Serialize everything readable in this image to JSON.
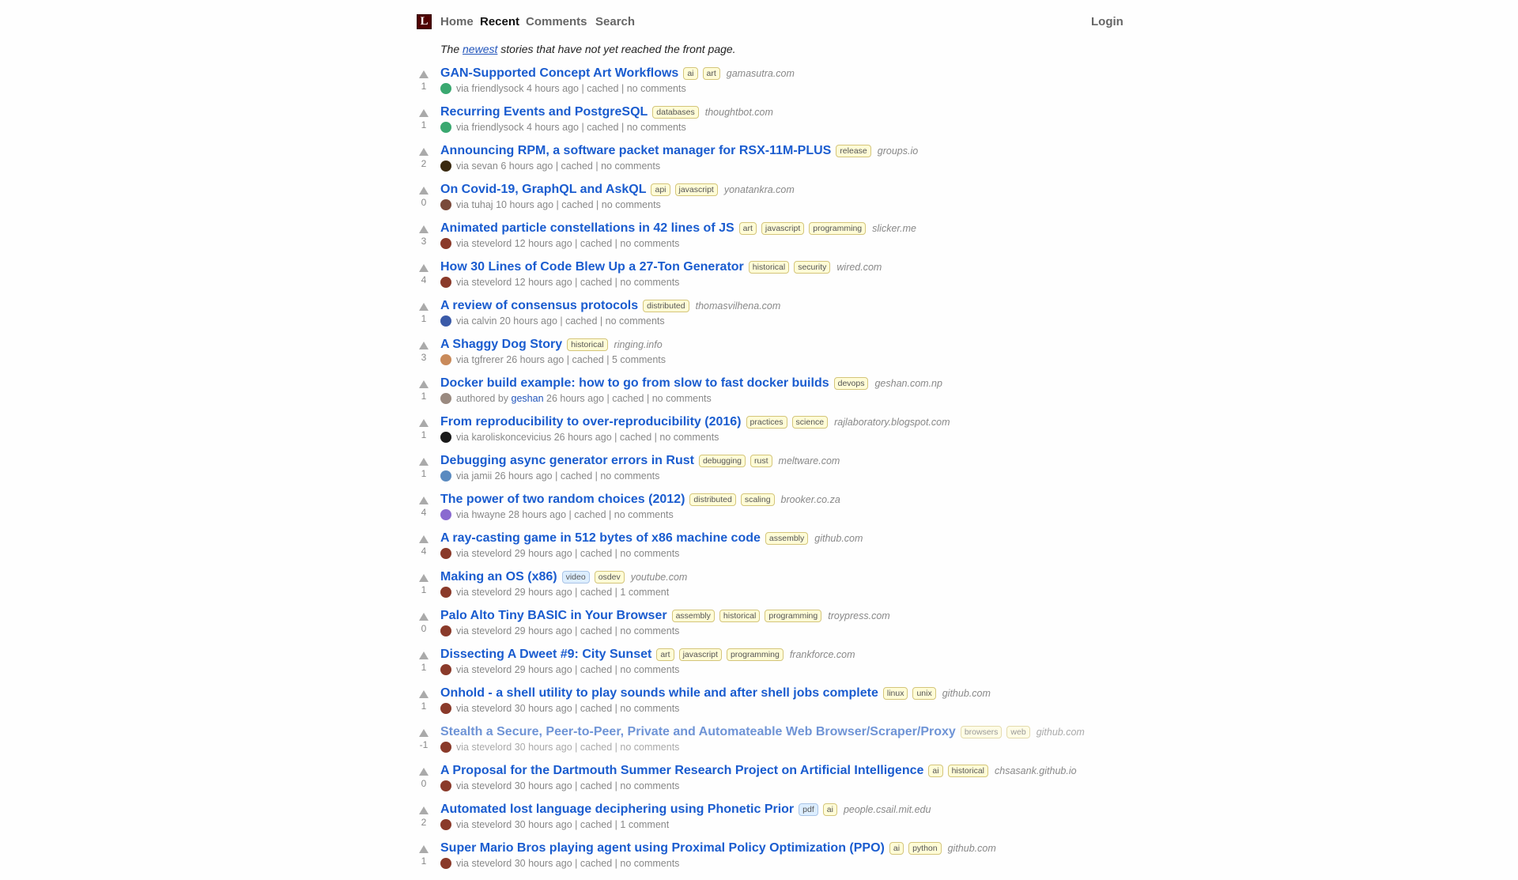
{
  "site": {
    "logo_letter": "L"
  },
  "nav": [
    {
      "label": "Home",
      "active": false
    },
    {
      "label": "Recent",
      "active": true
    },
    {
      "label": "Comments",
      "active": false
    },
    {
      "label": "Search",
      "active": false
    }
  ],
  "login_label": "Login",
  "subtitle": {
    "pre": "The ",
    "link": "newest",
    "post": " stories that have not yet reached the front page."
  },
  "colors": {
    "link": "#1a5ccf",
    "tag_bg": "#fffcd7",
    "media_tag_bg": "#ddeeff",
    "logo": "#500000"
  },
  "stories": [
    {
      "score": "1",
      "title": "GAN-Supported Concept Art Workflows",
      "tags": [
        "ai",
        "art"
      ],
      "domain": "gamasutra.com",
      "prefix": "via",
      "user": "friendlysock",
      "time": "4 hours ago",
      "cached": "cached",
      "comments": "no comments",
      "avatar": "#3aa870"
    },
    {
      "score": "1",
      "title": "Recurring Events and PostgreSQL",
      "tags": [
        "databases"
      ],
      "domain": "thoughtbot.com",
      "prefix": "via",
      "user": "friendlysock",
      "time": "4 hours ago",
      "cached": "cached",
      "comments": "no comments",
      "avatar": "#3aa870"
    },
    {
      "score": "2",
      "title": "Announcing RPM, a software packet manager for RSX-11M-PLUS",
      "tags": [
        "release"
      ],
      "domain": "groups.io",
      "prefix": "via",
      "user": "sevan",
      "time": "6 hours ago",
      "cached": "cached",
      "comments": "no comments",
      "avatar": "#3a2a10"
    },
    {
      "score": "0",
      "title": "On Covid-19, GraphQL and AskQL",
      "tags": [
        "api",
        "javascript"
      ],
      "domain": "yonatankra.com",
      "prefix": "via",
      "user": "tuhaj",
      "time": "10 hours ago",
      "cached": "cached",
      "comments": "no comments",
      "avatar": "#7a4a3a"
    },
    {
      "score": "3",
      "title": "Animated particle constellations in 42 lines of JS",
      "tags": [
        "art",
        "javascript",
        "programming"
      ],
      "domain": "slicker.me",
      "prefix": "via",
      "user": "stevelord",
      "time": "12 hours ago",
      "cached": "cached",
      "comments": "no comments",
      "avatar": "#8a3a2a"
    },
    {
      "score": "4",
      "title": "How 30 Lines of Code Blew Up a 27-Ton Generator",
      "tags": [
        "historical",
        "security"
      ],
      "domain": "wired.com",
      "prefix": "via",
      "user": "stevelord",
      "time": "12 hours ago",
      "cached": "cached",
      "comments": "no comments",
      "avatar": "#8a3a2a"
    },
    {
      "score": "1",
      "title": "A review of consensus protocols",
      "tags": [
        "distributed"
      ],
      "domain": "thomasvilhena.com",
      "prefix": "via",
      "user": "calvin",
      "time": "20 hours ago",
      "cached": "cached",
      "comments": "no comments",
      "avatar": "#3a5aa8"
    },
    {
      "score": "3",
      "title": "A Shaggy Dog Story",
      "tags": [
        "historical"
      ],
      "domain": "ringing.info",
      "prefix": "via",
      "user": "tgfrerer",
      "time": "26 hours ago",
      "cached": "cached",
      "comments": "5 comments",
      "avatar": "#c98a5a"
    },
    {
      "score": "1",
      "title": "Docker build example: how to go from slow to fast docker builds",
      "tags": [
        "devops"
      ],
      "domain": "geshan.com.np",
      "prefix": "authored by",
      "user": "geshan",
      "time": "26 hours ago",
      "cached": "cached",
      "comments": "no comments",
      "avatar": "#9a8a80",
      "author": true
    },
    {
      "score": "1",
      "title": "From reproducibility to over-reproducibility (2016)",
      "tags": [
        "practices",
        "science"
      ],
      "domain": "rajlaboratory.blogspot.com",
      "prefix": "via",
      "user": "karoliskoncevicius",
      "time": "26 hours ago",
      "cached": "cached",
      "comments": "no comments",
      "avatar": "#1a1a1a"
    },
    {
      "score": "1",
      "title": "Debugging async generator errors in Rust",
      "tags": [
        "debugging",
        "rust"
      ],
      "domain": "meltware.com",
      "prefix": "via",
      "user": "jamii",
      "time": "26 hours ago",
      "cached": "cached",
      "comments": "no comments",
      "avatar": "#5a8ac0"
    },
    {
      "score": "4",
      "title": "The power of two random choices (2012)",
      "tags": [
        "distributed",
        "scaling"
      ],
      "domain": "brooker.co.za",
      "prefix": "via",
      "user": "hwayne",
      "time": "28 hours ago",
      "cached": "cached",
      "comments": "no comments",
      "avatar": "#8a6ad0"
    },
    {
      "score": "4",
      "title": "A ray-casting game in 512 bytes of x86 machine code",
      "tags": [
        "assembly"
      ],
      "domain": "github.com",
      "prefix": "via",
      "user": "stevelord",
      "time": "29 hours ago",
      "cached": "cached",
      "comments": "no comments",
      "avatar": "#8a3a2a"
    },
    {
      "score": "1",
      "title": "Making an OS (x86)",
      "tags": [
        "video",
        "osdev"
      ],
      "media": [
        "video"
      ],
      "domain": "youtube.com",
      "prefix": "via",
      "user": "stevelord",
      "time": "29 hours ago",
      "cached": "cached",
      "comments": "1 comment",
      "avatar": "#8a3a2a"
    },
    {
      "score": "0",
      "title": "Palo Alto Tiny BASIC in Your Browser",
      "tags": [
        "assembly",
        "historical",
        "programming"
      ],
      "domain": "troypress.com",
      "prefix": "via",
      "user": "stevelord",
      "time": "29 hours ago",
      "cached": "cached",
      "comments": "no comments",
      "avatar": "#8a3a2a"
    },
    {
      "score": "1",
      "title": "Dissecting A Dweet #9: City Sunset",
      "tags": [
        "art",
        "javascript",
        "programming"
      ],
      "domain": "frankforce.com",
      "prefix": "via",
      "user": "stevelord",
      "time": "29 hours ago",
      "cached": "cached",
      "comments": "no comments",
      "avatar": "#8a3a2a"
    },
    {
      "score": "1",
      "title": "Onhold - a shell utility to play sounds while and after shell jobs complete",
      "tags": [
        "linux",
        "unix"
      ],
      "domain": "github.com",
      "prefix": "via",
      "user": "stevelord",
      "time": "30 hours ago",
      "cached": "cached",
      "comments": "no comments",
      "avatar": "#8a3a2a"
    },
    {
      "score": "-1",
      "title": "Stealth a Secure, Peer-to-Peer, Private and Automateable Web Browser/Scraper/Proxy",
      "tags": [
        "browsers",
        "web"
      ],
      "domain": "github.com",
      "prefix": "via",
      "user": "stevelord",
      "time": "30 hours ago",
      "cached": "cached",
      "comments": "no comments",
      "avatar": "#8a3a2a",
      "negative": true
    },
    {
      "score": "0",
      "title": "A Proposal for the Dartmouth Summer Research Project on Artificial Intelligence",
      "tags": [
        "ai",
        "historical"
      ],
      "domain": "chsasank.github.io",
      "prefix": "via",
      "user": "stevelord",
      "time": "30 hours ago",
      "cached": "cached",
      "comments": "no comments",
      "avatar": "#8a3a2a"
    },
    {
      "score": "2",
      "title": "Automated lost language deciphering using Phonetic Prior",
      "tags": [
        "pdf",
        "ai"
      ],
      "media": [
        "pdf"
      ],
      "domain": "people.csail.mit.edu",
      "prefix": "via",
      "user": "stevelord",
      "time": "30 hours ago",
      "cached": "cached",
      "comments": "1 comment",
      "avatar": "#8a3a2a"
    },
    {
      "score": "1",
      "title": "Super Mario Bros playing agent using Proximal Policy Optimization (PPO)",
      "tags": [
        "ai",
        "python"
      ],
      "domain": "github.com",
      "prefix": "via",
      "user": "stevelord",
      "time": "30 hours ago",
      "cached": "cached",
      "comments": "no comments",
      "avatar": "#8a3a2a"
    }
  ]
}
